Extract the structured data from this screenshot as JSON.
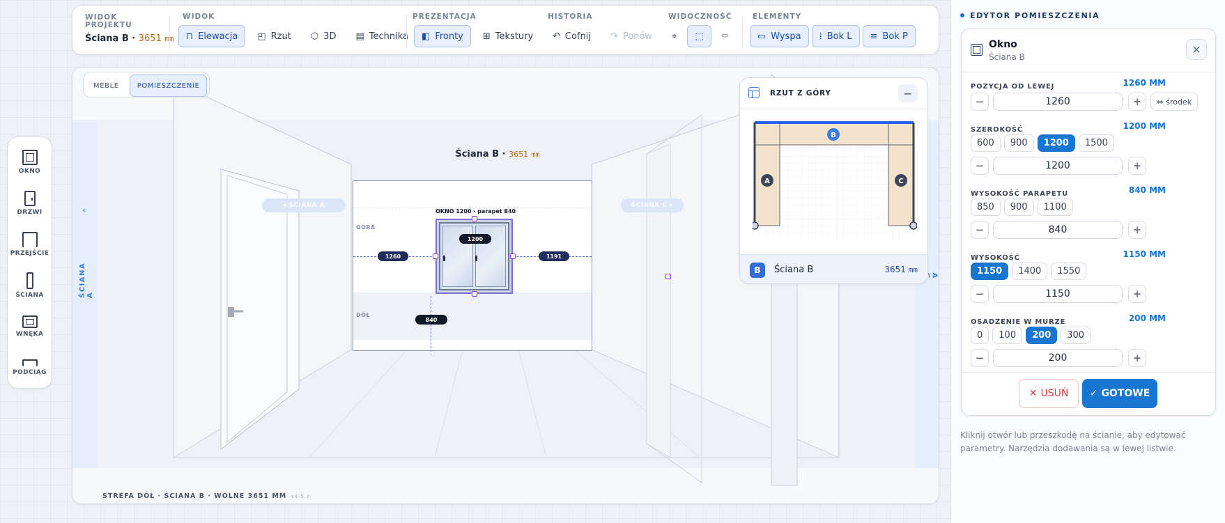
{
  "project": {
    "label": "WIDOK PROJEKTU",
    "wall": "Ściana B ·",
    "length": "3651",
    "unit": "mm"
  },
  "toolbar": {
    "widok": {
      "title": "WIDOK",
      "items": [
        {
          "label": "Elewacja",
          "icon": "elevation-icon",
          "active": true
        },
        {
          "label": "Rzut",
          "icon": "plan-icon",
          "active": false
        },
        {
          "label": "3D",
          "icon": "cube-icon",
          "active": false
        },
        {
          "label": "Technika",
          "icon": "document-icon",
          "active": false
        }
      ]
    },
    "prezentacja": {
      "title": "PREZENTACJA",
      "items": [
        {
          "label": "Fronty",
          "icon": "door-front-icon",
          "active": true
        },
        {
          "label": "Tekstury",
          "icon": "texture-grid-icon",
          "active": false
        }
      ]
    },
    "historia": {
      "title": "HISTORIA",
      "undo": "Cofnij",
      "redo": "Ponów"
    },
    "widocznosc": {
      "title": "WIDOCZNOŚĆ"
    },
    "elementy": {
      "title": "ELEMENTY",
      "items": [
        {
          "label": "Wyspa",
          "icon": "island-icon"
        },
        {
          "label": "Bok L",
          "icon": "side-left-icon"
        },
        {
          "label": "Bok P",
          "icon": "side-right-icon"
        }
      ]
    }
  },
  "mode": {
    "meble": "MEBLE",
    "pomieszczenie": "POMIESZCZENIE"
  },
  "left_tools": [
    {
      "label": "OKNO",
      "icon": "window-icon"
    },
    {
      "label": "DRZWI",
      "icon": "door-icon"
    },
    {
      "label": "PRZEJŚCIE",
      "icon": "passage-icon"
    },
    {
      "label": "ŚCIANA",
      "icon": "wall-icon"
    },
    {
      "label": "WNĘKA",
      "icon": "niche-icon"
    },
    {
      "label": "PODCIĄG",
      "icon": "beam-icon"
    }
  ],
  "scene": {
    "wall_title": "Ściana B ·",
    "wall_len": "3651",
    "wall_unit": "mm",
    "nav_left": "◂ ŚCIANA A",
    "nav_right": "ŚCIANA C ▸",
    "side_left": "ŚCIANA A",
    "side_right": "A C",
    "zone_top": "GÓRA",
    "zone_bottom": "DÓŁ",
    "window_label": "OKNO 1200 · parapet 840",
    "dim_width": "1200",
    "dim_left": "1260",
    "dim_right": "1191",
    "dim_sill": "840",
    "status": "STREFA DÓŁ · ŚCIANA B · WOLNE 3651 MM",
    "version": "v4.5.0"
  },
  "minimap": {
    "title": "RZUT Z GÓRY",
    "walls": [
      "A",
      "B",
      "C"
    ],
    "selected_letter": "B",
    "selected_name": "Ściana B",
    "selected_len": "3651",
    "selected_unit": "mm"
  },
  "editor": {
    "section_title": "EDYTOR POMIESZCZENIA",
    "item_name": "Okno",
    "item_wall": "Ściana B",
    "fields": [
      {
        "label": "POZYCJA OD LEWEJ",
        "value": "1260 MM",
        "input": "1260",
        "presets": [],
        "extra": "środek"
      },
      {
        "label": "SZEROKOŚĆ",
        "value": "1200 MM",
        "input": "1200",
        "presets": [
          "600",
          "900",
          "1200",
          "1500"
        ],
        "active": "1200"
      },
      {
        "label": "WYSOKOŚĆ PARAPETU",
        "value": "840 MM",
        "input": "840",
        "presets": [
          "850",
          "900",
          "1100"
        ],
        "active": ""
      },
      {
        "label": "WYSOKOŚĆ",
        "value": "1150 MM",
        "input": "1150",
        "presets": [
          "1150",
          "1400",
          "1550"
        ],
        "active": "1150"
      },
      {
        "label": "OSADZENIE W MURZE",
        "value": "200 MM",
        "input": "200",
        "presets": [
          "0",
          "100",
          "200",
          "300"
        ],
        "active": "200"
      }
    ],
    "delete": "USUŃ",
    "done": "GOTOWE",
    "hint": "Kliknij otwór lub przeszkodę na ścianie, aby edytować parametry. Narzędzia dodawania są w lewej listwie.",
    "colors": {
      "accent": "#1676d2",
      "danger": "#dc3c3c"
    }
  }
}
